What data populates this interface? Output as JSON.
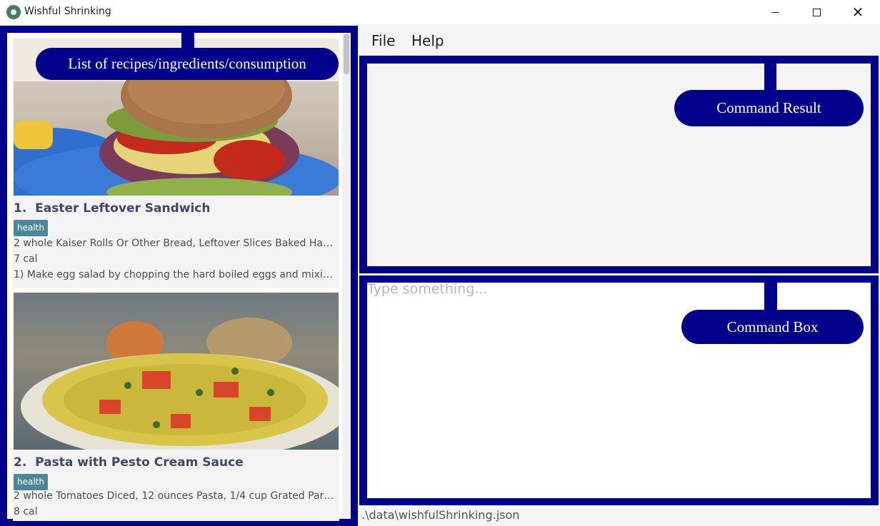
{
  "window": {
    "title": "Wishful Shrinking",
    "icon": "bowl-icon"
  },
  "menu": {
    "items": [
      "File",
      "Help"
    ]
  },
  "recipes": [
    {
      "index": "1.",
      "name": "Easter Leftover Sandwich",
      "tag": "health",
      "ingredients": "2 whole Kaiser Rolls Or Other Bread, Leftover Slices Baked Ha…",
      "calories": "7 cal",
      "instructions": "1) Make egg salad by chopping the hard boiled eggs and mixi…"
    },
    {
      "index": "2.",
      "name": "Pasta with Pesto Cream Sauce",
      "tag": "health",
      "ingredients": "2 whole Tomatoes Diced, 12 ounces Pasta, 1/4 cup Grated Par…",
      "calories": "8 cal"
    }
  ],
  "command_box": {
    "placeholder": "Type something..."
  },
  "status_bar": {
    "path": ".\\data\\wishfulShrinking.json"
  },
  "annotations": {
    "list": "List of recipes/ingredients/consumption",
    "result": "Command Result",
    "command": "Command Box"
  },
  "colors": {
    "frame": "#00008b",
    "tag": "#4c8799",
    "title_text": "#45456a"
  }
}
